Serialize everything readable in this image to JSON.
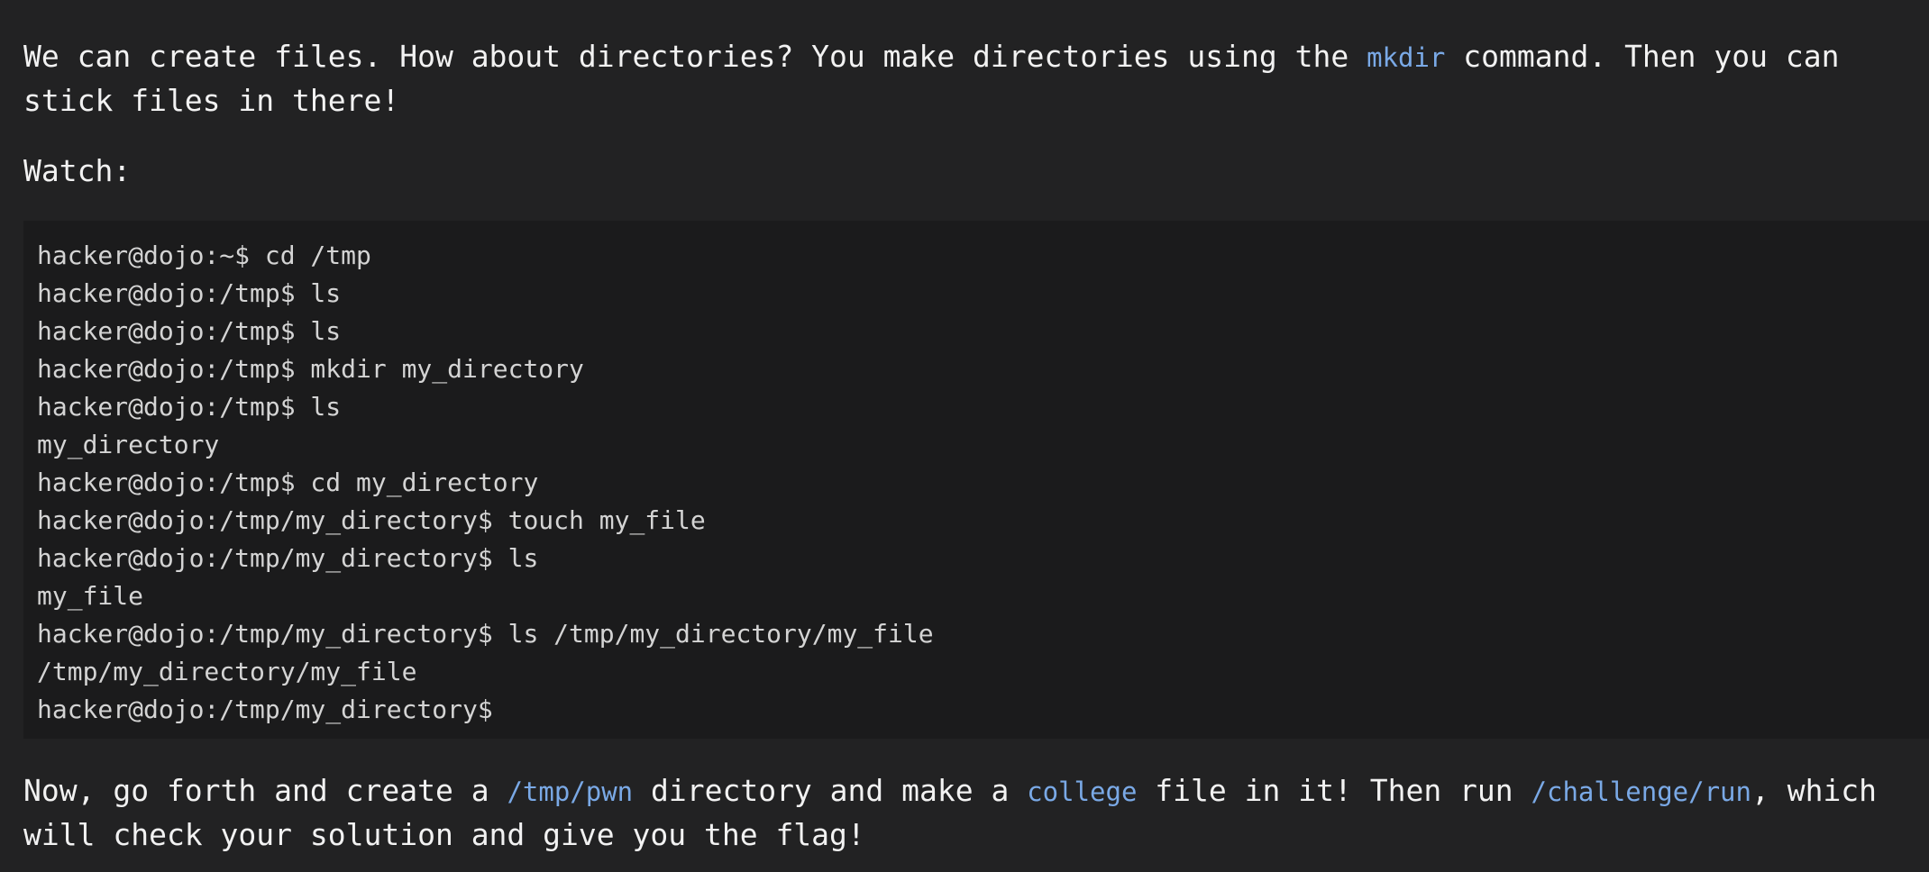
{
  "intro": {
    "part1": "We can create files. How about directories? You make directories using the ",
    "code1": "mkdir",
    "part2": " command. Then you can stick files in there!"
  },
  "watch_label": "Watch:",
  "terminal": {
    "lines": [
      "hacker@dojo:~$ cd /tmp",
      "hacker@dojo:/tmp$ ls",
      "hacker@dojo:/tmp$ ls",
      "hacker@dojo:/tmp$ mkdir my_directory",
      "hacker@dojo:/tmp$ ls",
      "my_directory",
      "hacker@dojo:/tmp$ cd my_directory",
      "hacker@dojo:/tmp/my_directory$ touch my_file",
      "hacker@dojo:/tmp/my_directory$ ls",
      "my_file",
      "hacker@dojo:/tmp/my_directory$ ls /tmp/my_directory/my_file",
      "/tmp/my_directory/my_file",
      "hacker@dojo:/tmp/my_directory$"
    ]
  },
  "outro": {
    "part1": "Now, go forth and create a ",
    "code1": "/tmp/pwn",
    "part2": " directory and make a ",
    "code2": "college",
    "part3": " file in it! Then run ",
    "code3": "/challenge/run",
    "part4": ", which will check your solution and give you the flag!"
  },
  "colors": {
    "background": "#222223",
    "terminal_bg": "#1b1b1c",
    "text": "#f2f2f2",
    "inline_code": "#7aa9e6"
  }
}
